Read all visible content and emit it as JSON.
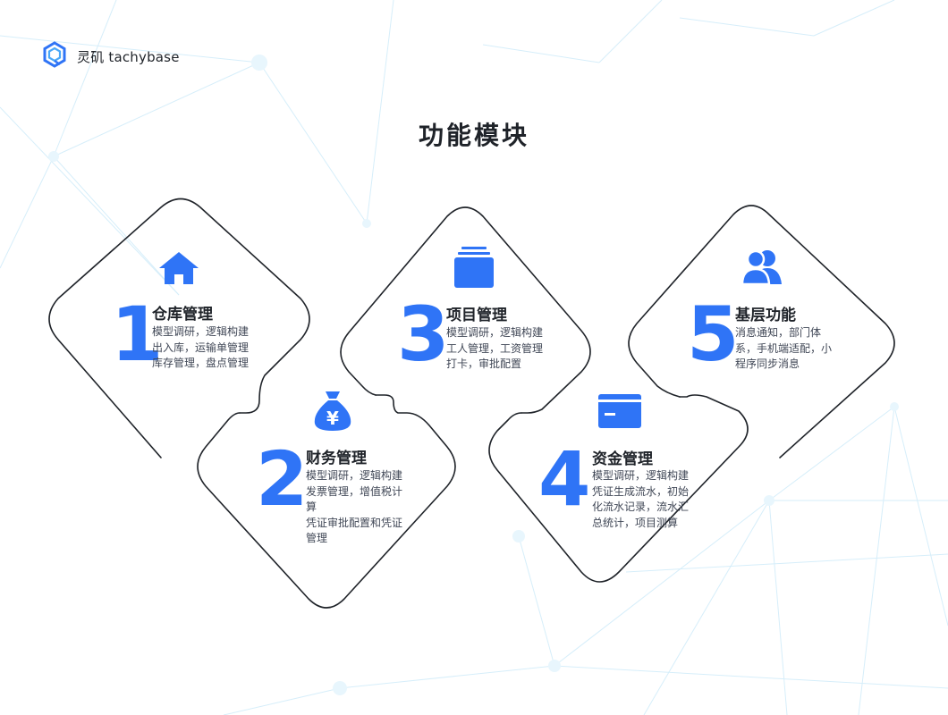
{
  "brand": {
    "name": "灵矶 tachybase",
    "icon": "hexagon-logo-icon"
  },
  "page": {
    "title": "功能模块"
  },
  "colors": {
    "accent": "#2f74f6",
    "outline": "#1f2329",
    "text": "#1f2329",
    "desc": "#404756"
  },
  "modules": [
    {
      "number": "1",
      "title": "仓库管理",
      "icon": "home-icon",
      "desc": [
        "模型调研，逻辑构建",
        "出入库，运输单管理",
        "库存管理，盘点管理"
      ]
    },
    {
      "number": "2",
      "title": "财务管理",
      "icon": "money-bag-icon",
      "desc": [
        "模型调研，逻辑构建",
        "发票管理，增值税计",
        "算",
        "凭证审批配置和凭证",
        "管理"
      ]
    },
    {
      "number": "3",
      "title": "项目管理",
      "icon": "stack-icon",
      "desc": [
        "模型调研，逻辑构建",
        "工人管理，工资管理",
        "打卡，审批配置"
      ]
    },
    {
      "number": "4",
      "title": "资金管理",
      "icon": "card-icon",
      "desc": [
        "模型调研，逻辑构建",
        "凭证生成流水，初始",
        "化流水记录，流水汇",
        "总统计，项目测算"
      ]
    },
    {
      "number": "5",
      "title": "基层功能",
      "icon": "users-icon",
      "desc": [
        "消息通知，部门体",
        "系，手机端适配，小",
        "程序同步消息"
      ]
    }
  ]
}
